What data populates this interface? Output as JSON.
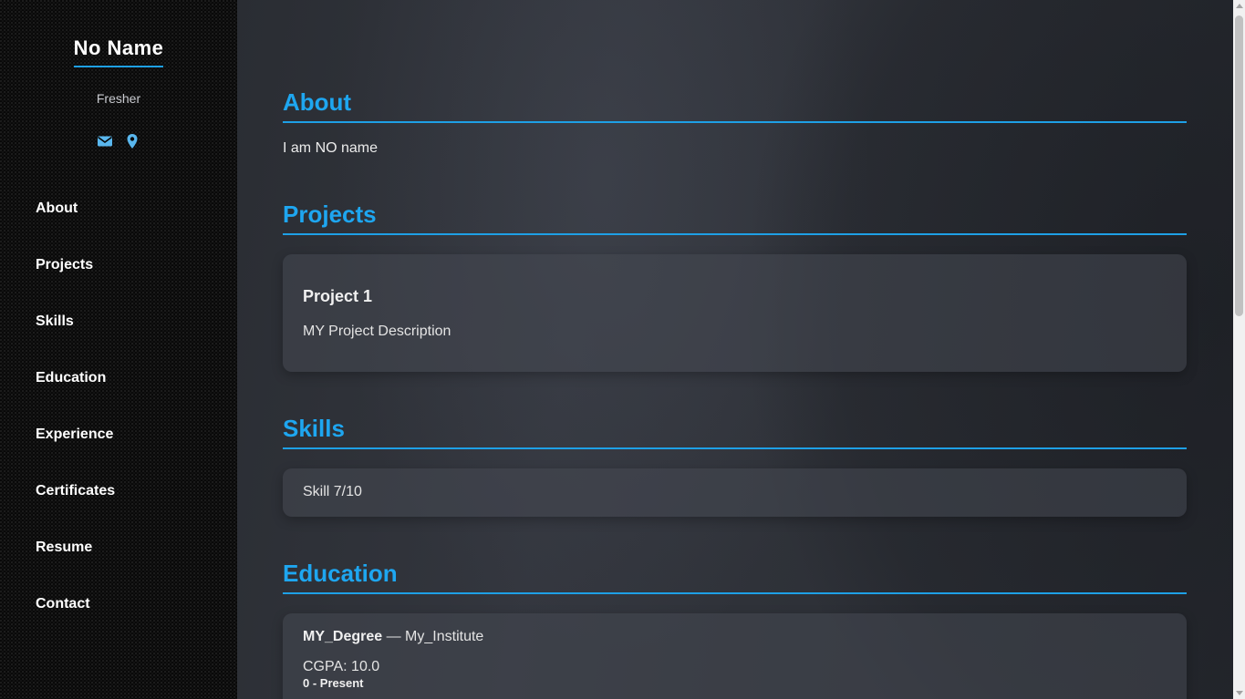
{
  "sidebar": {
    "name": "No Name",
    "role": "Fresher",
    "icons": [
      "envelope-icon",
      "map-pin-icon"
    ],
    "nav": [
      "About",
      "Projects",
      "Skills",
      "Education",
      "Experience",
      "Certificates",
      "Resume",
      "Contact"
    ]
  },
  "about": {
    "title": "About",
    "text": "I am NO name"
  },
  "projects": {
    "title": "Projects",
    "items": [
      {
        "name": "Project 1",
        "description": "MY Project Description"
      }
    ]
  },
  "skills": {
    "title": "Skills",
    "items": [
      "Skill 7/10"
    ]
  },
  "education": {
    "title": "Education",
    "items": [
      {
        "degree": "MY_Degree",
        "separator": " — ",
        "institute": "My_Institute",
        "cgpa": "CGPA: 10.0",
        "period": "0 - Present"
      }
    ]
  },
  "colors": {
    "accent": "#1ea6f0",
    "sidebar_bg": "#070707",
    "main_bg": "#2b2e35"
  }
}
